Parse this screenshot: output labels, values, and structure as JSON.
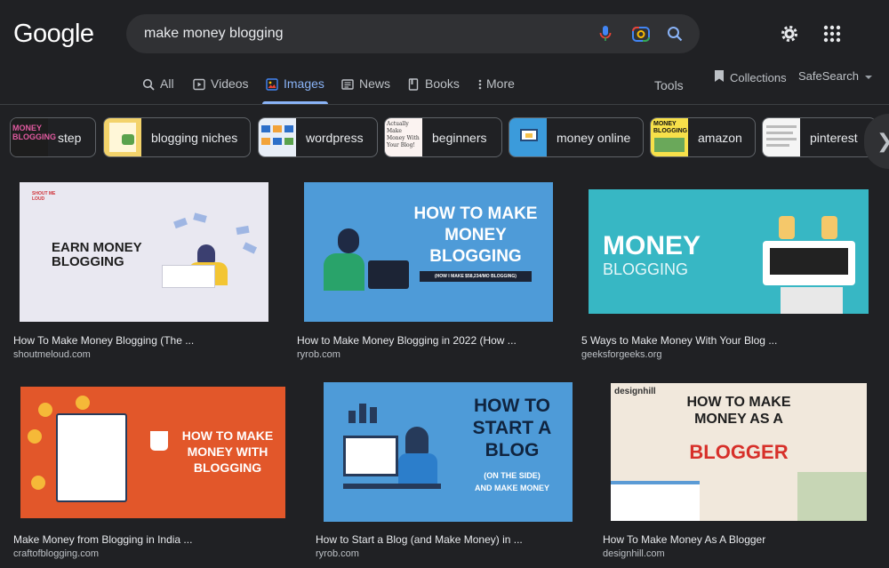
{
  "logo": "Google",
  "search": {
    "query": "make money blogging"
  },
  "tabs": [
    {
      "label": "All",
      "active": false
    },
    {
      "label": "Videos",
      "active": false
    },
    {
      "label": "Images",
      "active": true
    },
    {
      "label": "News",
      "active": false
    },
    {
      "label": "Books",
      "active": false
    },
    {
      "label": "More",
      "active": false
    }
  ],
  "tools": "Tools",
  "collections": "Collections",
  "safesearch": "SafeSearch",
  "chips": [
    {
      "label": "step",
      "thumb_text": "MONEY BLOGGING"
    },
    {
      "label": "blogging niches"
    },
    {
      "label": "wordpress"
    },
    {
      "label": "beginners",
      "thumb_text": "Actually Make Money With Your Blog!"
    },
    {
      "label": "money online"
    },
    {
      "label": "amazon",
      "thumb_text": "MONEY BLOGGING"
    },
    {
      "label": "pinterest"
    }
  ],
  "results": [
    {
      "title": "How To Make Money Blogging (The ...",
      "source": "shoutmeloud.com",
      "img_text": "EARN MONEY BLOGGING",
      "brand": "SHOUT ME LOUD",
      "bg": "#e9e8f1"
    },
    {
      "title": "How to Make Money Blogging in 2022 (How ...",
      "source": "ryrob.com",
      "img_text": "HOW TO MAKE MONEY BLOGGING",
      "img_sub": "(HOW I MAKE $58,234/MO BLOGGING)",
      "bg": "#4e9bd8"
    },
    {
      "title": "5 Ways to Make Money With Your Blog ...",
      "source": "geeksforgeeks.org",
      "img_text": "MONEY",
      "img_text2": "BLOGGING",
      "bg": "#37b7c4"
    },
    {
      "title": "Make Money from Blogging in India ...",
      "source": "craftofblogging.com",
      "img_text": "HOW TO MAKE MONEY WITH BLOGGING",
      "bg": "#e2572a"
    },
    {
      "title": "How to Start a Blog (and Make Money) in ...",
      "source": "ryrob.com",
      "img_text": "HOW TO START A BLOG",
      "img_sub": "(ON THE SIDE)",
      "img_sub2": "AND MAKE MONEY",
      "bg": "#4e9bd8"
    },
    {
      "title": "How To Make Money As A Blogger",
      "source": "designhill.com",
      "img_text": "HOW TO MAKE MONEY AS A",
      "img_text2": "BLOGGER",
      "brand": "designhill",
      "bg": "#f1e8dc"
    }
  ]
}
